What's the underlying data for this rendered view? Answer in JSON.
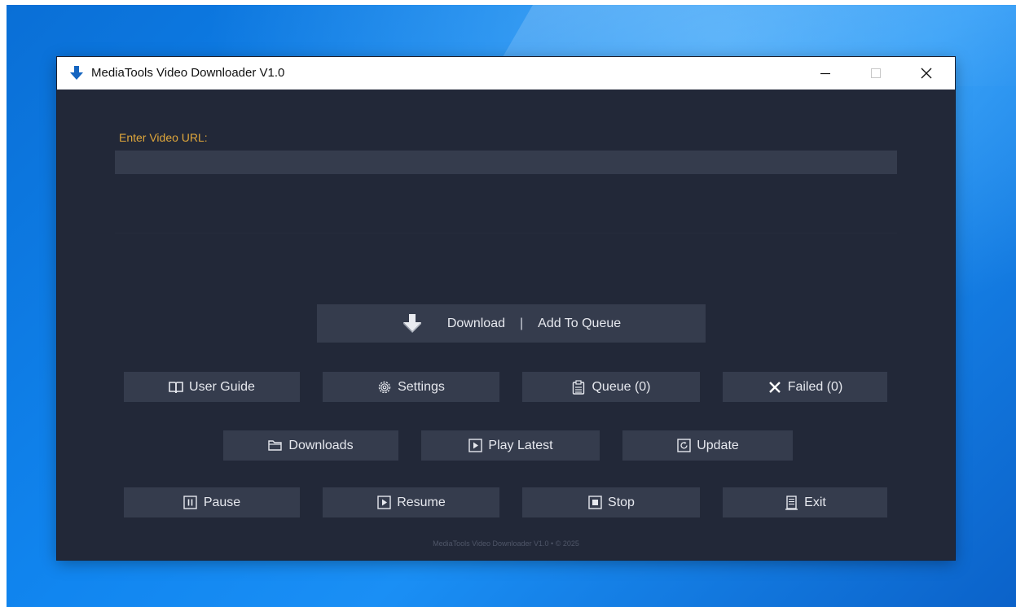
{
  "window": {
    "title": "MediaTools Video Downloader V1.0",
    "controls": {
      "minimize": "minimize-icon",
      "maximize": "maximize-icon",
      "close": "close-icon"
    }
  },
  "url": {
    "label": "Enter Video URL:",
    "value": "",
    "placeholder": ""
  },
  "actions": {
    "download_label": "Download",
    "separator": "|",
    "queue_label": "Add To Queue"
  },
  "row1": {
    "user_guide": "User Guide",
    "settings": "Settings",
    "queue": "Queue (0)",
    "failed": "Failed (0)"
  },
  "row2": {
    "downloads": "Downloads",
    "play_latest": "Play Latest",
    "update": "Update"
  },
  "row3": {
    "pause": "Pause",
    "resume": "Resume",
    "stop": "Stop",
    "exit": "Exit"
  },
  "footer": {
    "text": "MediaTools Video Downloader V1.0 • © 2025"
  },
  "colors": {
    "window_bg": "#222838",
    "button_bg": "#353c4d",
    "label_accent": "#e0a73b",
    "text": "#e6e8ee",
    "app_icon": "#1565c0"
  }
}
